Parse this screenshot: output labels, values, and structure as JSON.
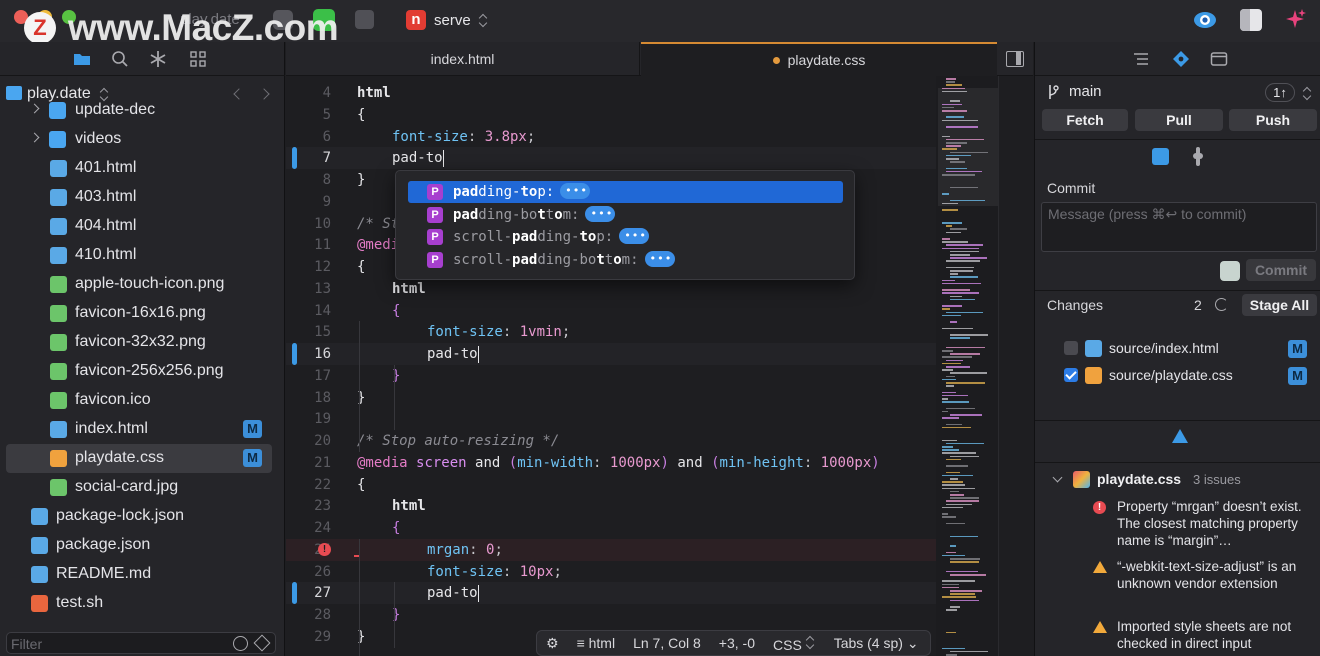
{
  "titlebar": {
    "watermark": "www.MacZ.com",
    "watermark_logo": "Z",
    "project": "play.date",
    "serve_logo": "n",
    "serve_label": "serve"
  },
  "sidebar": {
    "project_name": "play.date",
    "items": [
      {
        "label": "update-dec",
        "kind": "folder",
        "icon_color": "#4aa6f0",
        "indent": 1
      },
      {
        "label": "videos",
        "kind": "folder",
        "icon_color": "#4aa6f0",
        "indent": 1
      },
      {
        "label": "401.html",
        "kind": "file",
        "icon_color": "#5aa9e6",
        "indent": 2
      },
      {
        "label": "403.html",
        "kind": "file",
        "icon_color": "#5aa9e6",
        "indent": 2
      },
      {
        "label": "404.html",
        "kind": "file",
        "icon_color": "#5aa9e6",
        "indent": 2
      },
      {
        "label": "410.html",
        "kind": "file",
        "icon_color": "#5aa9e6",
        "indent": 2
      },
      {
        "label": "apple-touch-icon.png",
        "kind": "file",
        "icon_color": "#6cc56a",
        "indent": 2
      },
      {
        "label": "favicon-16x16.png",
        "kind": "file",
        "icon_color": "#6cc56a",
        "indent": 2
      },
      {
        "label": "favicon-32x32.png",
        "kind": "file",
        "icon_color": "#6cc56a",
        "indent": 2
      },
      {
        "label": "favicon-256x256.png",
        "kind": "file",
        "icon_color": "#6cc56a",
        "indent": 2
      },
      {
        "label": "favicon.ico",
        "kind": "file",
        "icon_color": "#6cc56a",
        "indent": 2
      },
      {
        "label": "index.html",
        "kind": "file",
        "icon_color": "#5aa9e6",
        "indent": 2,
        "badge": "M"
      },
      {
        "label": "playdate.css",
        "kind": "file",
        "icon_color": "#f0a23e",
        "indent": 2,
        "badge": "M",
        "selected": true
      },
      {
        "label": "social-card.jpg",
        "kind": "file",
        "icon_color": "#6cc56a",
        "indent": 2
      },
      {
        "label": "package-lock.json",
        "kind": "file",
        "icon_color": "#5aa9e6",
        "indent": 1
      },
      {
        "label": "package.json",
        "kind": "file",
        "icon_color": "#5aa9e6",
        "indent": 1
      },
      {
        "label": "README.md",
        "kind": "file",
        "icon_color": "#5aa9e6",
        "indent": 1
      },
      {
        "label": "test.sh",
        "kind": "file",
        "icon_color": "#e9663e",
        "indent": 1
      }
    ],
    "filter_placeholder": "Filter"
  },
  "editor": {
    "tabs": [
      {
        "label": "index.html"
      },
      {
        "label": "playdate.css",
        "dirty": true
      }
    ],
    "lines": [
      {
        "n": "4",
        "tokens": [
          [
            "tag",
            "html"
          ]
        ],
        "indent": 0
      },
      {
        "n": "5",
        "tokens": [
          [
            "plain",
            "{"
          ]
        ],
        "indent": 0
      },
      {
        "n": "6",
        "tokens": [
          [
            "prop",
            "font-size"
          ],
          [
            "punc",
            ": "
          ],
          [
            "num",
            "3.8px"
          ],
          [
            "punc",
            ";"
          ]
        ],
        "indent": 1
      },
      {
        "n": "7",
        "tokens": [
          [
            "plain",
            "pad-to"
          ]
        ],
        "indent": 1,
        "cursor": true,
        "modified": true,
        "current": true
      },
      {
        "n": "8",
        "tokens": [
          [
            "plain",
            "}"
          ]
        ],
        "indent": 0
      },
      {
        "n": "9",
        "tokens": [],
        "indent": 0
      },
      {
        "n": "10",
        "tokens": [
          [
            "comment",
            "/* St"
          ]
        ],
        "indent": 0
      },
      {
        "n": "11",
        "tokens": [
          [
            "at",
            "@medi"
          ],
          [
            "plain",
            "                                        "
          ],
          [
            "paren",
            "px)"
          ]
        ],
        "indent": 0
      },
      {
        "n": "12",
        "tokens": [
          [
            "plain",
            "{"
          ]
        ],
        "indent": 0
      },
      {
        "n": "13",
        "tokens": [
          [
            "tag",
            "html"
          ]
        ],
        "indent": 1
      },
      {
        "n": "14",
        "tokens": [
          [
            "paren",
            "{"
          ]
        ],
        "indent": 1
      },
      {
        "n": "15",
        "tokens": [
          [
            "prop",
            "font-size"
          ],
          [
            "punc",
            ": "
          ],
          [
            "num",
            "1vmin"
          ],
          [
            "punc",
            ";"
          ]
        ],
        "indent": 2
      },
      {
        "n": "16",
        "tokens": [
          [
            "plain",
            "pad-to"
          ]
        ],
        "indent": 2,
        "cursor": true,
        "modified": true,
        "current": true
      },
      {
        "n": "17",
        "tokens": [
          [
            "paren",
            "}"
          ]
        ],
        "indent": 1
      },
      {
        "n": "18",
        "tokens": [
          [
            "plain",
            "}"
          ]
        ],
        "indent": 0
      },
      {
        "n": "19",
        "tokens": [],
        "indent": 0
      },
      {
        "n": "20",
        "tokens": [
          [
            "comment",
            "/* Stop auto-resizing */"
          ]
        ],
        "indent": 0
      },
      {
        "n": "21",
        "tokens": [
          [
            "at",
            "@media"
          ],
          [
            "plain",
            " "
          ],
          [
            "kw",
            "screen"
          ],
          [
            "plain",
            " and "
          ],
          [
            "paren",
            "("
          ],
          [
            "prop",
            "min-width"
          ],
          [
            "punc",
            ": "
          ],
          [
            "num",
            "1000px"
          ],
          [
            "paren",
            ")"
          ],
          [
            "plain",
            " and "
          ],
          [
            "paren",
            "("
          ],
          [
            "prop",
            "min-height"
          ],
          [
            "punc",
            ": "
          ],
          [
            "num",
            "1000px"
          ],
          [
            "paren",
            ")"
          ]
        ],
        "indent": 0
      },
      {
        "n": "22",
        "tokens": [
          [
            "plain",
            "{"
          ]
        ],
        "indent": 0
      },
      {
        "n": "23",
        "tokens": [
          [
            "tag",
            "html"
          ]
        ],
        "indent": 1
      },
      {
        "n": "24",
        "tokens": [
          [
            "paren",
            "{"
          ]
        ],
        "indent": 1
      },
      {
        "n": "25",
        "tokens": [
          [
            "prop",
            "mrgan"
          ],
          [
            "punc",
            ": "
          ],
          [
            "num",
            "0"
          ],
          [
            "punc",
            ";"
          ]
        ],
        "indent": 2,
        "error": true
      },
      {
        "n": "26",
        "tokens": [
          [
            "prop",
            "font-size"
          ],
          [
            "punc",
            ": "
          ],
          [
            "num",
            "10px"
          ],
          [
            "punc",
            ";"
          ]
        ],
        "indent": 2
      },
      {
        "n": "27",
        "tokens": [
          [
            "plain",
            "pad-to"
          ]
        ],
        "indent": 2,
        "cursor": true,
        "modified": true,
        "current": true
      },
      {
        "n": "28",
        "tokens": [
          [
            "paren",
            "}"
          ]
        ],
        "indent": 1
      },
      {
        "n": "29",
        "tokens": [
          [
            "plain",
            "}"
          ]
        ],
        "indent": 0
      }
    ],
    "completion": [
      {
        "kind": "P",
        "parts": [
          [
            "b",
            "pad"
          ],
          [
            "n",
            "ding-"
          ],
          [
            "b",
            "to"
          ],
          [
            "n",
            "p:"
          ]
        ],
        "selected": true
      },
      {
        "kind": "P",
        "parts": [
          [
            "b",
            "pad"
          ],
          [
            "n",
            "ding-bo"
          ],
          [
            "b",
            "t"
          ],
          [
            "n",
            "t"
          ],
          [
            "b",
            "o"
          ],
          [
            "n",
            "m:"
          ]
        ]
      },
      {
        "kind": "P",
        "parts": [
          [
            "n",
            "scroll-"
          ],
          [
            "b",
            "pad"
          ],
          [
            "n",
            "ding-"
          ],
          [
            "b",
            "to"
          ],
          [
            "n",
            "p:"
          ]
        ]
      },
      {
        "kind": "P",
        "parts": [
          [
            "n",
            "scroll-"
          ],
          [
            "b",
            "pad"
          ],
          [
            "n",
            "ding-bo"
          ],
          [
            "b",
            "t"
          ],
          [
            "n",
            "t"
          ],
          [
            "b",
            "o"
          ],
          [
            "n",
            "m:"
          ]
        ]
      }
    ]
  },
  "statusbar": {
    "language_symbol": "html",
    "position": "Ln 7, Col 8",
    "diff": "+3, -0",
    "syntax": "CSS",
    "indent": "Tabs (4 sp)"
  },
  "git": {
    "branch": "main",
    "ahead": "1↑",
    "buttons": [
      "Fetch",
      "Pull",
      "Push"
    ],
    "commit_label": "Commit",
    "commit_placeholder": "Message (press ⌘↩ to commit)",
    "commit_button": "Commit",
    "changes_label": "Changes",
    "changes_count": "2",
    "stage_all": "Stage All",
    "changes": [
      {
        "path": "source/index.html",
        "checked": false,
        "badge": "M",
        "icon_color": "#5aa9e6"
      },
      {
        "path": "source/playdate.css",
        "checked": true,
        "badge": "M",
        "icon_color": "#f0a23e"
      }
    ]
  },
  "issues": {
    "file": "playdate.css",
    "count": "3 issues",
    "items": [
      {
        "severity": "error",
        "text": "Property “mrgan” doesn’t exist. The closest matching property name is “margin”…"
      },
      {
        "severity": "warning",
        "text": "“-webkit-text-size-adjust” is an unknown vendor extension"
      },
      {
        "severity": "warning",
        "text": "Imported style sheets are not checked in direct input"
      }
    ]
  },
  "colors": {
    "accent": "#2068d6",
    "modified_badge": "#3c8fd9",
    "error": "#e84b52",
    "warning": "#f2a93b",
    "tab_dirty": "#e49a3e"
  }
}
